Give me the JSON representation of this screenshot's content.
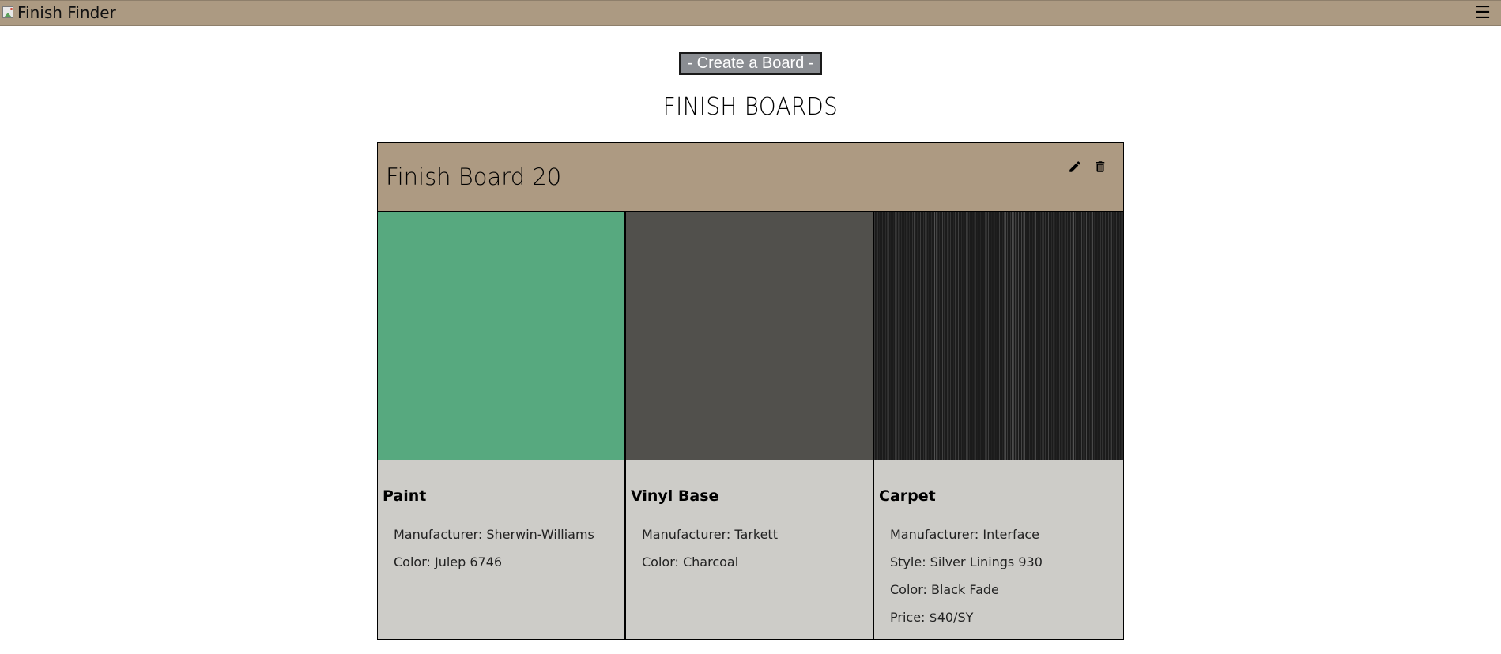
{
  "header": {
    "brand_text": "Finish Finder",
    "brand_image_icon": "broken-image-icon",
    "menu_icon": "hamburger-menu-icon",
    "menu_glyph": "☰"
  },
  "actions": {
    "create_board_label": "- Create a Board -"
  },
  "page": {
    "title": "FINISH BOARDS"
  },
  "board": {
    "title": "Finish Board 20",
    "edit_icon": "pencil-icon",
    "delete_icon": "trash-icon",
    "items": [
      {
        "name": "Paint",
        "swatch_color": "#57a97f",
        "specs": [
          "Manufacturer: Sherwin-Williams",
          "Color: Julep 6746"
        ]
      },
      {
        "name": "Vinyl Base",
        "swatch_color": "#51504c",
        "specs": [
          "Manufacturer: Tarkett",
          "Color: Charcoal"
        ]
      },
      {
        "name": "Carpet",
        "swatch_color": "#1b1b1b",
        "specs": [
          "Manufacturer: Interface",
          "Style: Silver Linings 930",
          "Color: Black Fade",
          "Price: $40/SY"
        ]
      }
    ]
  },
  "colors": {
    "header_bg": "#ac9a82",
    "button_bg": "#8a8d92",
    "info_bg": "#cdccc8"
  }
}
